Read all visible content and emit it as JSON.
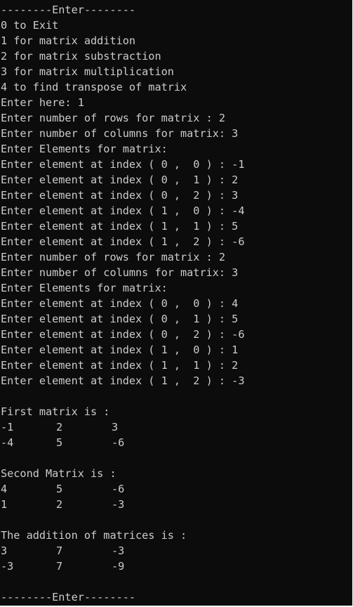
{
  "console": {
    "lines": [
      "--------Enter--------",
      "0 to Exit",
      "1 for matrix addition",
      "2 for matrix substraction",
      "3 for matrix multiplication",
      "4 to find transpose of matrix",
      "Enter here: 1",
      "Enter number of rows for matrix : 2",
      "Enter number of columns for matrix: 3",
      "Enter Elements for matrix:",
      "Enter element at index ( 0 ,  0 ) : -1",
      "Enter element at index ( 0 ,  1 ) : 2",
      "Enter element at index ( 0 ,  2 ) : 3",
      "Enter element at index ( 1 ,  0 ) : -4",
      "Enter element at index ( 1 ,  1 ) : 5",
      "Enter element at index ( 1 ,  2 ) : -6",
      "Enter number of rows for matrix : 2",
      "Enter number of columns for matrix: 3",
      "Enter Elements for matrix:",
      "Enter element at index ( 0 ,  0 ) : 4",
      "Enter element at index ( 0 ,  1 ) : 5",
      "Enter element at index ( 0 ,  2 ) : -6",
      "Enter element at index ( 1 ,  0 ) : 1",
      "Enter element at index ( 1 ,  1 ) : 2",
      "Enter element at index ( 1 ,  2 ) : -3",
      ""
    ],
    "first_matrix": {
      "heading": "First matrix is :",
      "rows": [
        [
          "-1",
          "2",
          "3"
        ],
        [
          "-4",
          "5",
          "-6"
        ]
      ]
    },
    "second_matrix": {
      "heading": "Second Matrix is :",
      "rows": [
        [
          "4",
          "5",
          "-6"
        ],
        [
          "1",
          "2",
          "-3"
        ]
      ]
    },
    "result_matrix": {
      "heading": "The addition of matrices is :",
      "rows": [
        [
          "3",
          "7",
          "-3"
        ],
        [
          "-3",
          "7",
          "-9"
        ]
      ]
    },
    "footer": "--------Enter--------",
    "text_color": "#cccccc",
    "background_color": "#0c0c0c"
  }
}
